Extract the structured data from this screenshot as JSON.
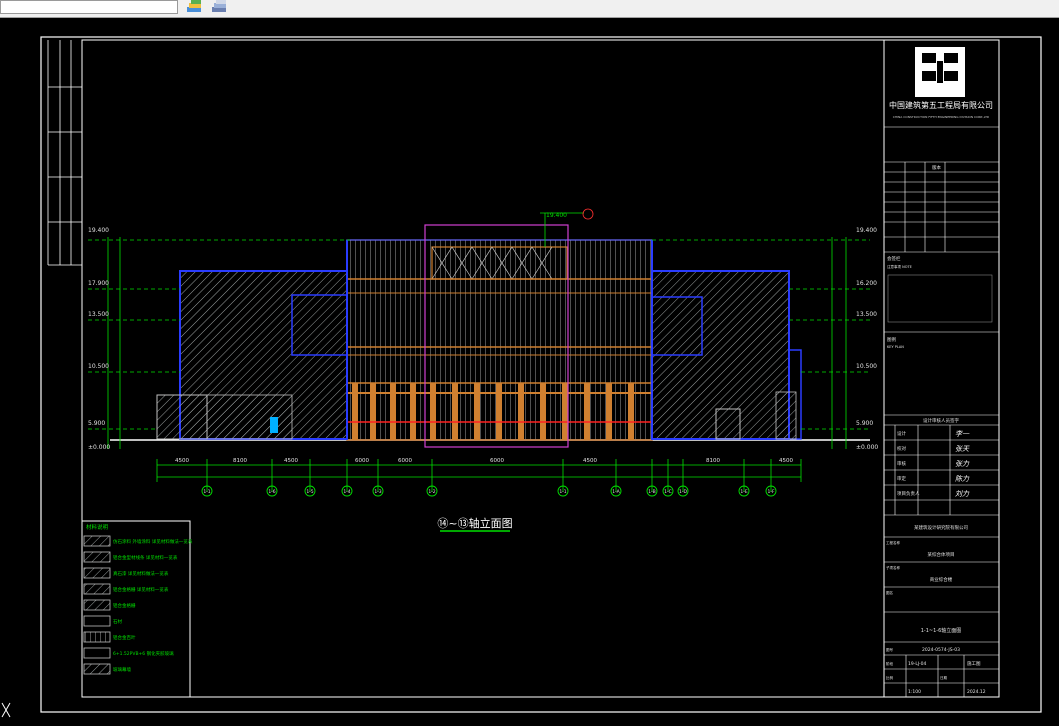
{
  "toolbar": {
    "icons": [
      "layers-icon",
      "layer-stack-icon"
    ]
  },
  "drawing": {
    "title": "⑭~⑬轴立面图",
    "top_elevation": "19.400",
    "axis_tags": [
      "1-1",
      "1-6",
      "1-5",
      "1-4",
      "1-3",
      "1-2",
      "1-1",
      "1-A",
      "1-B",
      "1-C",
      "1-D",
      "1-E",
      "1-F"
    ],
    "dimensions": [
      "4500",
      "8100",
      "4500",
      "6000",
      "6000",
      "6000",
      "4500",
      "8100",
      "4500"
    ],
    "levels_left": [
      "19.400",
      "17.900",
      "13.500",
      "10.500",
      "5.900",
      "±0.000"
    ],
    "levels_right": [
      "19.400",
      "16.200",
      "13.500",
      "10.500",
      "5.900",
      "±0.000"
    ]
  },
  "legend": {
    "title": "材料说明",
    "items": [
      "仿石涂料  外墙涂料  详见材料做法一览表",
      "铝合金型材线条  详见材料一览表",
      "真石漆  详见材料做法一览表",
      "铝合金格栅  详见材料一览表",
      "铝合金格栅",
      "石材",
      "铝合金百叶",
      "6+1.52PVB+6 钢化夹胶玻璃",
      "玻璃幕墙"
    ]
  },
  "titleblock": {
    "company_cn": "中国建筑第五工程局有限公司",
    "company_en": "CHINA CONSTRUCTION FIFTH ENGINEERING DIVISION CORP.,LTD",
    "table_header": "版本",
    "notes_label": "会签栏",
    "notes_sub": "注意事项 NOTE",
    "key_plan_label": "图例",
    "key_plan_sub": "KEY PLAN",
    "approval_header": "设计审核人员签字",
    "roles": [
      "设计",
      "校对",
      "审核",
      "审定",
      "项目负责人"
    ],
    "signatures": [
      "李一",
      "张天",
      "张力",
      "陈力",
      "刘力"
    ],
    "design_firm": "某建筑设计研究院有限公司",
    "project_label": "工程名称",
    "project": "某综合体项目",
    "subproject_label": "子项名称",
    "subproject": "商业综合楼",
    "drawing_label": "图名",
    "drawing_name": "1-1~1-6轴立面图",
    "drawing_no_label": "图号",
    "drawing_no": "2024-0574-JS-03",
    "phase_label": "阶段",
    "phase": "施工图",
    "sheet_no": "19-LJ-04",
    "scale_label": "比例",
    "scale": "1:100",
    "date_label": "日期",
    "date": "2024.12"
  }
}
